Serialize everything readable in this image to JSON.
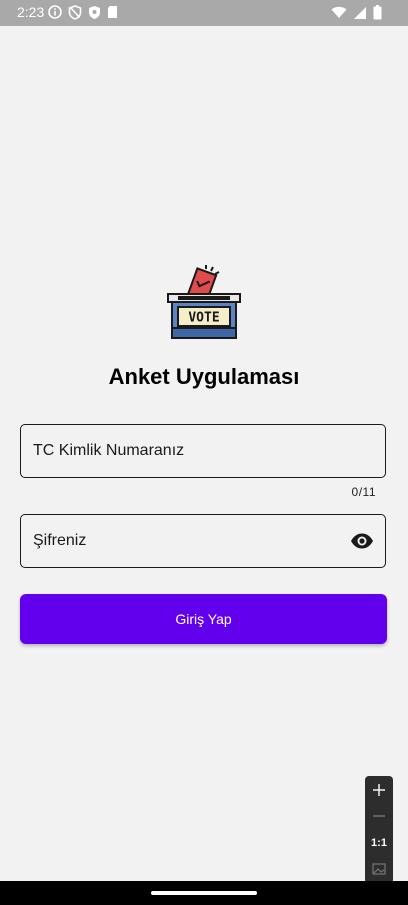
{
  "status_bar": {
    "time": "2:23",
    "left_icons": [
      "info-icon",
      "shield-icon",
      "vpn-icon",
      "sd-card-icon"
    ],
    "right_icons": [
      "wifi-icon",
      "signal-icon",
      "battery-icon"
    ]
  },
  "login": {
    "logo_text": "VOTE",
    "title": "Anket Uygulaması",
    "tc_placeholder": "TC Kimlik Numaranız",
    "tc_counter": "0/11",
    "password_placeholder": "Şifreniz",
    "password_toggle_icon": "eye-icon",
    "login_button": "Giriş Yap"
  },
  "zoom_controls": {
    "one_to_one": "1:1"
  },
  "colors": {
    "accent": "#6200ee",
    "background": "#f2f2f2",
    "status_bar": "#a9a9a9"
  }
}
